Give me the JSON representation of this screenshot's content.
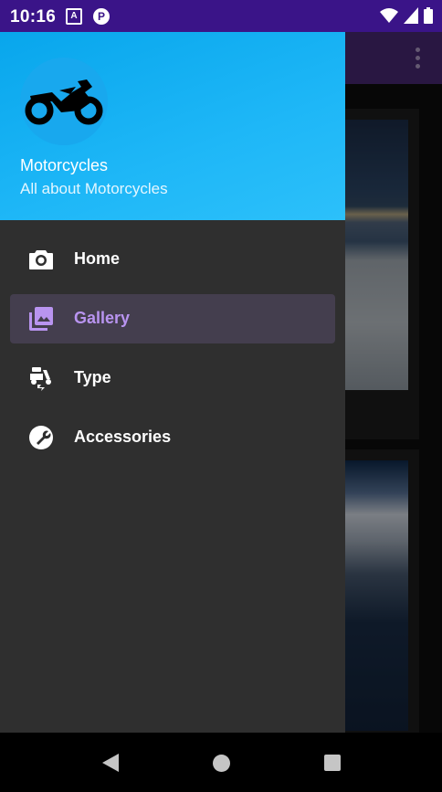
{
  "status_bar": {
    "time": "10:16",
    "left_icons": [
      "A",
      "P"
    ],
    "right_icons": [
      "wifi-icon",
      "signal-icon",
      "battery-icon"
    ]
  },
  "drawer": {
    "header": {
      "title": "Motorcycles",
      "subtitle": "All about Motorcycles",
      "avatar_icon": "motorcycle-icon"
    },
    "items": [
      {
        "label": "Home",
        "icon": "camera-icon",
        "active": false
      },
      {
        "label": "Gallery",
        "icon": "gallery-icon",
        "active": true
      },
      {
        "label": "Type",
        "icon": "scooter-icon",
        "active": false
      },
      {
        "label": "Accessories",
        "icon": "wrench-icon",
        "active": false
      }
    ]
  },
  "colors": {
    "status_bar": "#3a1488",
    "header_gradient_start": "#08a6ec",
    "drawer_bg": "#2f2f2f",
    "active_item_bg": "#443e4e",
    "active_item_accent": "#b994f0"
  }
}
